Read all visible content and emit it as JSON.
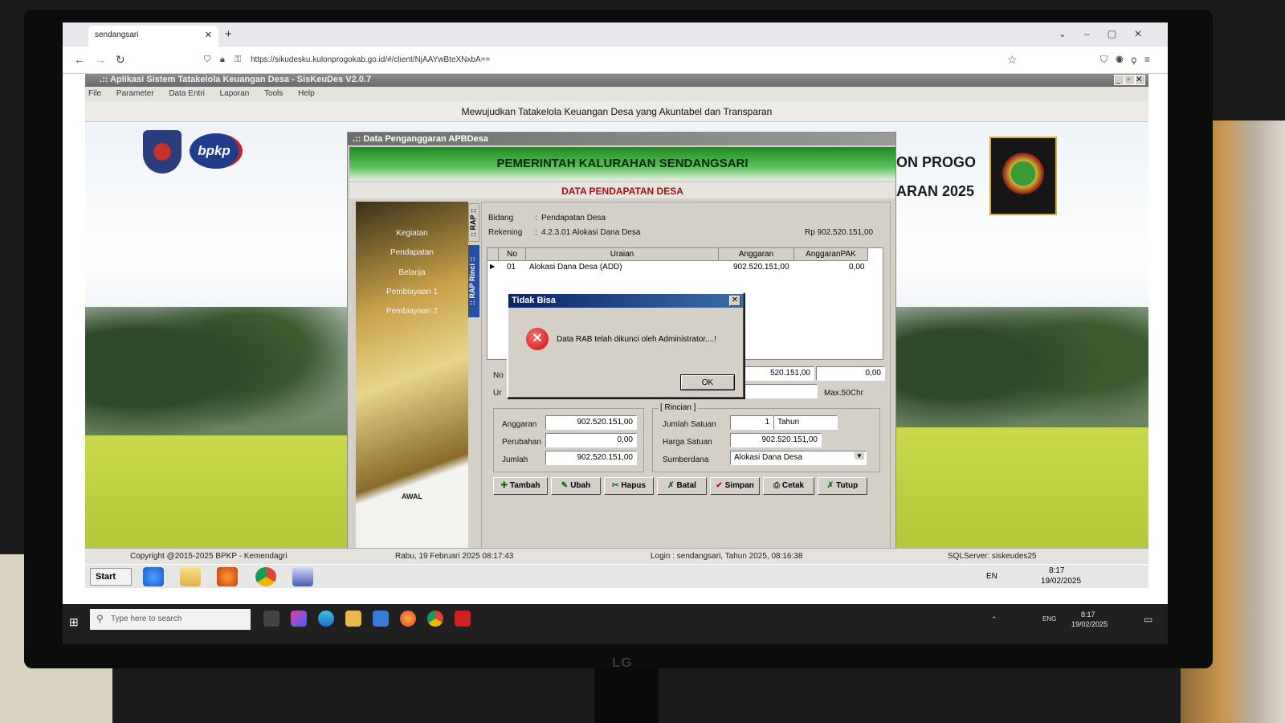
{
  "browser": {
    "tab_title": "sendangsari",
    "url": "https://sikudesku.kulonprogokab.go.id/#/client/NjAAYwBteXNxbA=="
  },
  "app": {
    "title": ".:: Aplikasi Sistem Tatakelola Keuangan Desa - SisKeuDes V2.0.7",
    "menu": [
      "File",
      "Parameter",
      "Data Entri",
      "Laporan",
      "Tools",
      "Help"
    ],
    "banner": "Mewujudkan Tatakelola Keuangan Desa yang Akuntabel dan Transparan",
    "logo_text": "bpkp",
    "side_title_1": "ON PROGO",
    "side_title_2": "ARAN 2025"
  },
  "window": {
    "title": ".:: Data Penganggaran APBDesa",
    "header": "PEMERINTAH KALURAHAN SENDANGSARI",
    "subheader": "DATA PENDAPATAN DESA",
    "nav": [
      "Kegiatan",
      "Pendapatan",
      "Belanja",
      "Pembiayaan 1",
      "Pembiayaan 2"
    ],
    "nav_awal": "AWAL",
    "vtabs": [
      ":: RAP ::",
      ":: RAP Rinci ::"
    ],
    "bidang_label": "Bidang",
    "bidang_value": "Pendapatan Desa",
    "rekening_label": "Rekening",
    "rekening_value": "4.2.3.01   Alokasi Dana Desa",
    "rekening_total": "Rp 902.520.151,00",
    "grid_headers": [
      "No",
      "Uraian",
      "Anggaran",
      "AnggaranPAK"
    ],
    "grid_rows": [
      {
        "no": "01",
        "uraian": "Alokasi Dana Desa (ADD)",
        "anggaran": "902.520.151,00",
        "pak": "0,00"
      }
    ],
    "no_label": "No",
    "ur_label": "Ur",
    "total_partial": "520.151,00",
    "total_pak": "0,00",
    "max_chr": "Max.50Chr",
    "anggaran_label": "Anggaran",
    "anggaran_value": "902.520.151,00",
    "perubahan_label": "Perubahan",
    "perubahan_value": "0,00",
    "jumlah_label": "Jumlah",
    "jumlah_value": "902.520.151,00",
    "rincian_title": "[ Rincian ]",
    "jumlah_satuan_label": "Jumlah Satuan",
    "jumlah_satuan_value": "1",
    "satuan_value": "Tahun",
    "harga_satuan_label": "Harga Satuan",
    "harga_satuan_value": "902.520.151,00",
    "sumberdana_label": "Sumberdana",
    "sumberdana_value": "Alokasi Dana Desa",
    "buttons": [
      "Tambah",
      "Ubah",
      "Hapus",
      "Batal",
      "Simpan",
      "Cetak",
      "Tutup"
    ]
  },
  "dialog": {
    "title": "Tidak Bisa",
    "message": "Data RAB telah dikunci oleh Administrator....!",
    "ok": "OK"
  },
  "status": {
    "copyright": "Copyright @2015-2025 BPKP - Kemendagri",
    "datetime": "Rabu, 19 Februari 2025  08:17:43",
    "login": "Login : sendangsari,  Tahun 2025, 08:16:38",
    "server": "SQLServer: siskeudes25"
  },
  "xp_taskbar": {
    "start": "Start",
    "lang": "EN",
    "time": "8:17",
    "date": "19/02/2025"
  },
  "w10_taskbar": {
    "search_placeholder": "Type here to search",
    "lang": "ENG",
    "time": "8:17",
    "date": "19/02/2025"
  },
  "monitor_brand": "LG"
}
